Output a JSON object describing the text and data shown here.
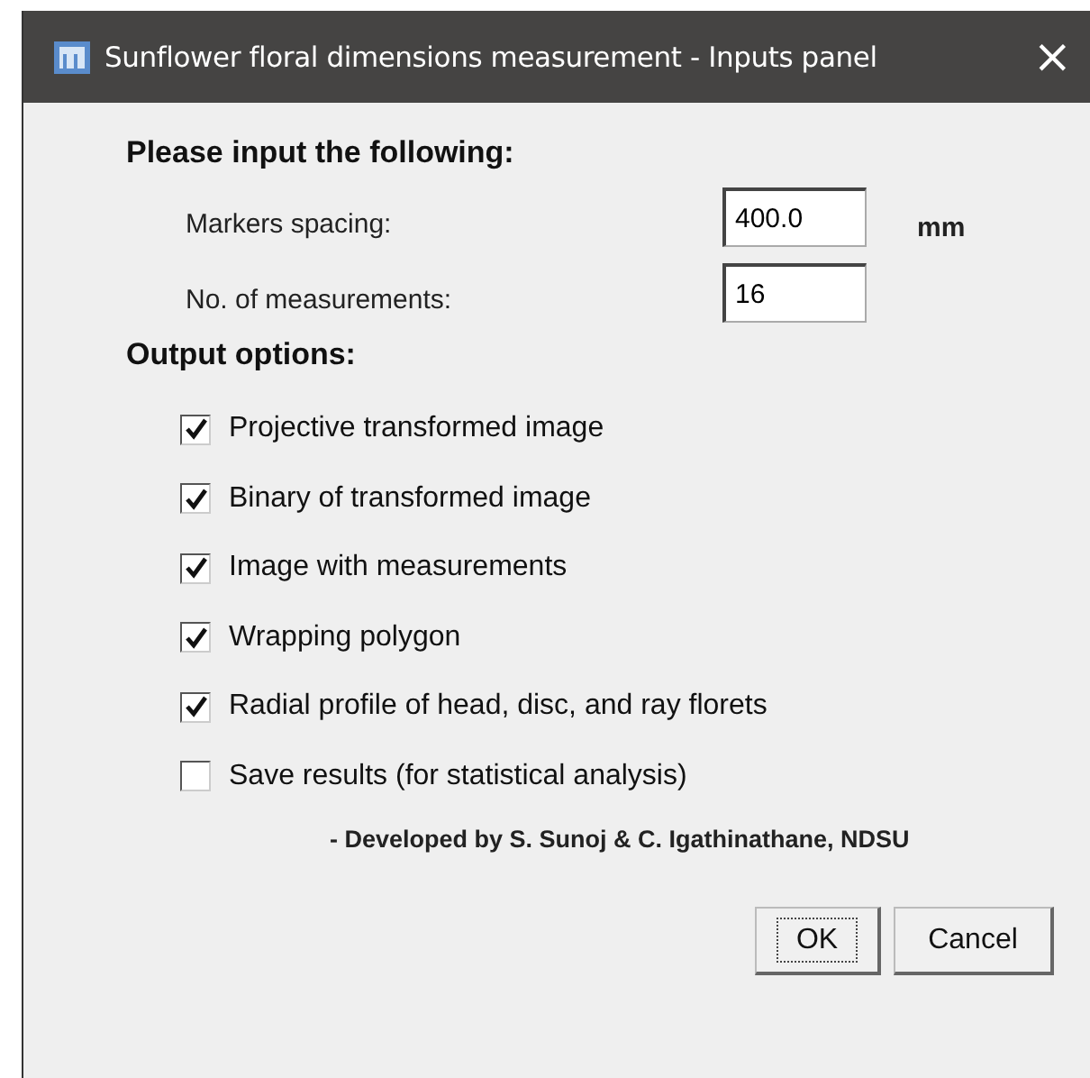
{
  "window": {
    "title": "Sunflower floral dimensions measurement - Inputs panel",
    "close": "×"
  },
  "inputs": {
    "heading": "Please input the following:",
    "fields": [
      {
        "label": "Markers spacing:",
        "value": "400.0",
        "unit": "mm"
      },
      {
        "label": "No. of measurements:",
        "value": "16"
      }
    ]
  },
  "output": {
    "heading": "Output options:",
    "options": [
      {
        "label": "Projective transformed image",
        "checked": true
      },
      {
        "label": "Binary of transformed image",
        "checked": true
      },
      {
        "label": "Image with measurements",
        "checked": true
      },
      {
        "label": "Wrapping polygon",
        "checked": true
      },
      {
        "label": "Radial profile of head, disc, and ray florets",
        "checked": true
      },
      {
        "label": "Save results (for statistical analysis)",
        "checked": false
      }
    ]
  },
  "credit": "- Developed by S. Sunoj & C. Igathinathane, NDSU",
  "buttons": [
    {
      "label": "OK",
      "focused": true
    },
    {
      "label": "Cancel",
      "focused": false
    }
  ]
}
